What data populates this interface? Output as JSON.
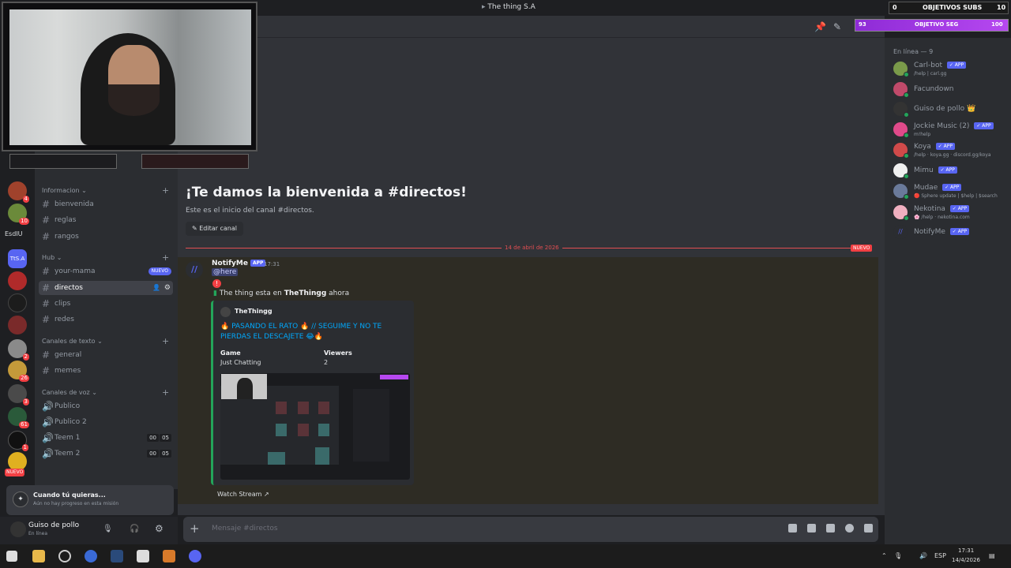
{
  "window": {
    "title": "The thing S.A"
  },
  "overlay": {
    "subs_label": "OBJETIVOS SUBS",
    "subs_current": "0",
    "subs_goal": "10",
    "seg_label": "OBJETIVO SEG",
    "seg_current": "93",
    "seg_goal": "100"
  },
  "rail": {
    "server_name_label": "EsdIU",
    "server_ttsa": "TtS.A",
    "nuevo": "NUEVO",
    "badges": [
      "4",
      "10",
      "2",
      "26",
      "3",
      "61",
      "1"
    ]
  },
  "sidebar": {
    "categories": [
      {
        "name": "Informacion",
        "channels": [
          {
            "name": "bienvenida"
          },
          {
            "name": "reglas"
          },
          {
            "name": "rangos"
          }
        ]
      },
      {
        "name": "Hub",
        "channels": [
          {
            "name": "your-mama",
            "badge": "NUEVO"
          },
          {
            "name": "directos",
            "active": true
          },
          {
            "name": "clips"
          },
          {
            "name": "redes"
          }
        ]
      },
      {
        "name": "Canales de texto",
        "channels": [
          {
            "name": "general"
          },
          {
            "name": "memes"
          }
        ]
      },
      {
        "name": "Canales de voz",
        "channels": [
          {
            "name": "Publico"
          },
          {
            "name": "Publico 2"
          },
          {
            "name": "Teem 1",
            "a": "00",
            "b": "05"
          },
          {
            "name": "Teem 2",
            "a": "00",
            "b": "05"
          }
        ]
      }
    ]
  },
  "quest": {
    "title": "Cuando tú quieras...",
    "subtitle": "Aún no hay progreso en esta misión"
  },
  "user": {
    "name": "Guiso de pollo",
    "status": "En línea"
  },
  "welcome": {
    "title": "¡Te damos la bienvenida a #directos!",
    "subtitle": "Este es el inicio del canal #directos.",
    "edit_label": "Editar canal"
  },
  "divider": {
    "date": "14 de abril de 2026",
    "nuevo": "NUEVO"
  },
  "message": {
    "author": "NotifyMe",
    "app_badge": "APP",
    "time": "17:31",
    "mention": "@here",
    "live_prefix": "The thing esta en",
    "live_channel": "TheThingg",
    "live_suffix": "ahora",
    "embed": {
      "author": "TheThingg",
      "title": "🔥 PASANDO EL RATO 🔥 // SEGUIME Y NO TE PIERDAS EL DESCAJETE 😂🔥",
      "field1_name": "Game",
      "field1_value": "Just Chatting",
      "field2_name": "Viewers",
      "field2_value": "2"
    },
    "watch_label": "Watch Stream"
  },
  "composer": {
    "placeholder": "Mensaje #directos"
  },
  "members": {
    "heading": "En línea — 9",
    "list": [
      {
        "name": "Carl-bot",
        "app": "✓ APP",
        "sub": "/help | carl.gg",
        "color": "#7a9a4a"
      },
      {
        "name": "Facundown",
        "app": "",
        "sub": "",
        "color": "#c04a6a"
      },
      {
        "name": "Guiso de pollo",
        "app": "",
        "sub": "",
        "crown": "👑",
        "color": "#333333"
      },
      {
        "name": "Jockie Music (2)",
        "app": "✓ APP",
        "sub": "m!help",
        "color": "#e04a8a"
      },
      {
        "name": "Koya",
        "app": "✓ APP",
        "sub": "/help · koya.gg · discord.gg/koya",
        "color": "#d04a4a"
      },
      {
        "name": "Mimu",
        "app": "✓ APP",
        "sub": "",
        "color": "#f0f0f0"
      },
      {
        "name": "Mudae",
        "app": "✓ APP",
        "sub": "🔴 Sphere update | $help | $search",
        "color": "#6a7a9a"
      },
      {
        "name": "Nekotina",
        "app": "✓ APP",
        "sub": "🌸 /help · nekotina.com",
        "color": "#f0b0c0"
      },
      {
        "name": "NotifyMe",
        "app": "✓ APP",
        "sub": "",
        "color": "#2b2d31"
      }
    ]
  },
  "taskbar": {
    "lang": "ESP",
    "time": "17:31",
    "date": "14/4/2026"
  }
}
